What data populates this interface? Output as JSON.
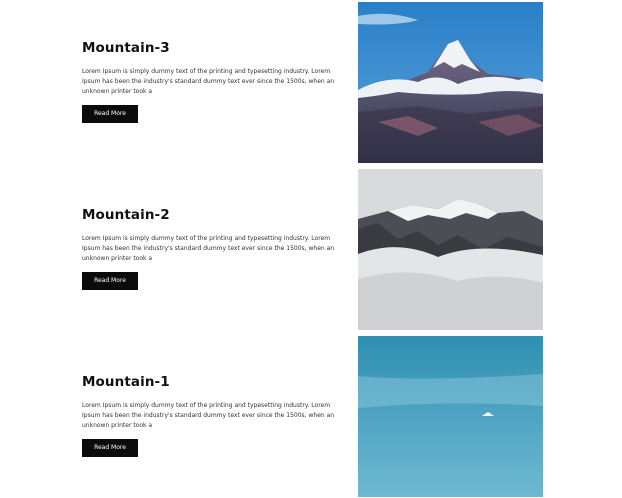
{
  "items": [
    {
      "title": "Mountain-3",
      "body": "Lorem Ipsum is simply dummy text of the printing and typesetting industry. Lorem Ipsum has been the industry's standard dummy text ever since the 1500s, when an unknown printer took a",
      "button_label": "Read More"
    },
    {
      "title": "Mountain-2",
      "body": "Lorem Ipsum is simply dummy text of the printing and typesetting industry. Lorem Ipsum has been the industry's standard dummy text ever since the 1500s, when an unknown printer took a",
      "button_label": "Read More"
    },
    {
      "title": "Mountain-1",
      "body": "Lorem Ipsum is simply dummy text of the printing and typesetting industry. Lorem Ipsum has been the industry's standard dummy text ever since the 1500s, when an unknown printer took a",
      "button_label": "Read More"
    }
  ],
  "colors": {
    "button_bg": "#0b0b0b",
    "button_text": "#ffffff",
    "title": "#111111",
    "body_text": "#333333"
  }
}
